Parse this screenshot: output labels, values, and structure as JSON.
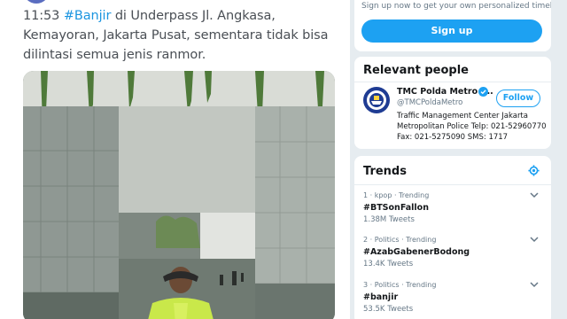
{
  "tweet": {
    "time": "11:53",
    "hashtag": "#Banjir",
    "text": " di Underpass Jl. Angkasa, Kemayoran, Jakarta Pusat, sementara tidak bisa dilintasi semua jenis ranmor.",
    "photo_icon": "flooded-underpass-photo"
  },
  "signup": {
    "prompt": "Sign up now to get your own personalized timeline!",
    "button_label": "Sign up"
  },
  "relevant_people": {
    "title": "Relevant people",
    "name": "TMC Polda Metro J...",
    "handle": "@TMCPoldaMetro",
    "bio": "Traffic Management Center Jakarta Metropolitan Police Telp: 021-52960770 Fax: 021-5275090 SMS: 1717",
    "follow_label": "Follow",
    "avatar_icon": "police-emblem-avatar",
    "verified_icon": "verified-badge-icon"
  },
  "trends": {
    "title": "Trends",
    "settings_icon": "gear-icon",
    "items": [
      {
        "meta": "1 · kpop · Trending",
        "name": "#BTSonFallon",
        "count": "1.38M Tweets"
      },
      {
        "meta": "2 · Politics · Trending",
        "name": "#AzabGabenerBodong",
        "count": "13.4K Tweets"
      },
      {
        "meta": "3 · Politics · Trending",
        "name": "#banjir",
        "count": "53.5K Tweets"
      }
    ]
  },
  "colors": {
    "accent": "#1da1f2",
    "hashtag": "#1b95e0",
    "background": "#e6ecf0"
  }
}
